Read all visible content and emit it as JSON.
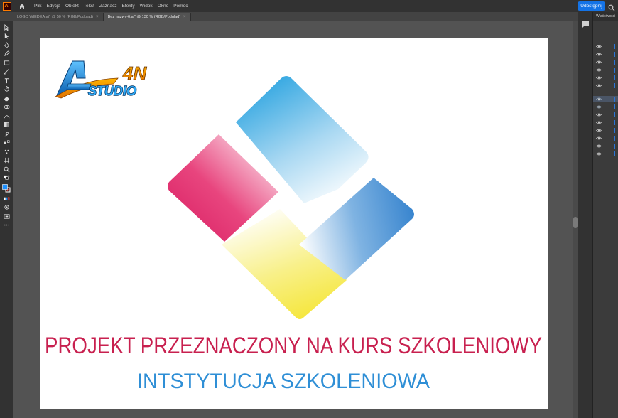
{
  "menubar": {
    "app_icon": "Ai",
    "items": [
      "Plik",
      "Edycja",
      "Obiekt",
      "Tekst",
      "Zaznacz",
      "Efekty",
      "Widok",
      "Okno",
      "Pomoc"
    ],
    "share_label": "Udostępnij"
  },
  "tabs": [
    {
      "label": "LOGO WIEDEA.ai* @ 50 % (RGB/Podgląd)",
      "active": false
    },
    {
      "label": "Bez nazwy-6.ai* @ 130 % (RGB/Podgląd)",
      "active": true
    }
  ],
  "tab_close_glyph": "×",
  "panel": {
    "title": "Właściwości"
  },
  "artwork": {
    "logo": {
      "text_4n": "4N",
      "text_studio": "STUDIO"
    },
    "headline": "PROJEKT PRZEZNACZONY NA KURS SZKOLENIOWY",
    "subheadline": "INTSTYTUCJA SZKOLENIOWA"
  },
  "colors": {
    "headline": "#c8204f",
    "subheadline": "#2f8fd6",
    "share": "#1473e6",
    "fill_swatch": "#1e90ff",
    "magenta": "#d81b60",
    "cyan": "#29a3e0",
    "yellow": "#f5eb3a",
    "blue": "#3a86cf"
  },
  "tool_icons": [
    "selection-tool-icon",
    "direct-selection-tool-icon",
    "pen-tool-icon",
    "pencil-tool-icon",
    "rectangle-tool-icon",
    "brush-tool-icon",
    "type-tool-icon",
    "rotate-tool-icon",
    "eraser-tool-icon",
    "shape-builder-icon",
    "width-tool-icon",
    "gradient-tool-icon",
    "eyedropper-tool-icon",
    "blend-tool-icon",
    "symbol-sprayer-icon",
    "artboard-tool-icon",
    "zoom-tool-icon",
    "swap-colors-icon",
    "fill-stroke-icon",
    "color-mode-icon",
    "draw-mode-icon",
    "screen-mode-icon",
    "more-tools-icon"
  ]
}
